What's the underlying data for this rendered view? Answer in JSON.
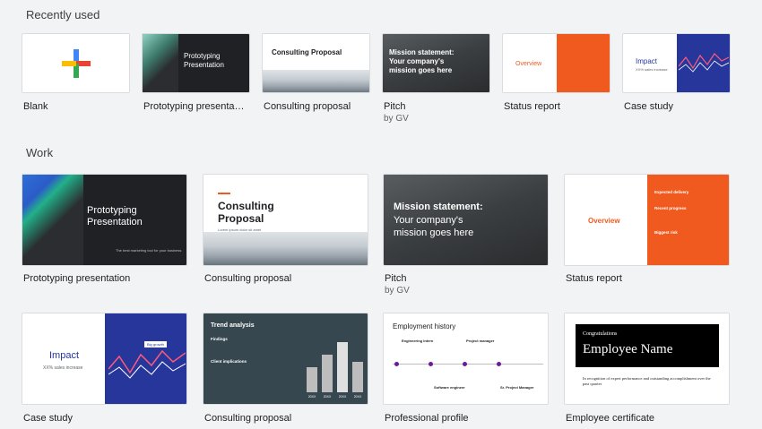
{
  "sections": {
    "recent": "Recently used",
    "work": "Work"
  },
  "recent": [
    {
      "caption": "Blank"
    },
    {
      "caption": "Prototyping presentati…",
      "title": "Prototyping Presentation"
    },
    {
      "caption": "Consulting proposal",
      "title": "Consulting Proposal"
    },
    {
      "caption": "Pitch",
      "sub": "by GV",
      "title": "Mission statement: Your company's mission goes here"
    },
    {
      "caption": "Status report",
      "title": "Overview"
    },
    {
      "caption": "Case study",
      "title": "Impact",
      "subtitle": "XX% sales increase"
    }
  ],
  "work_row1": [
    {
      "caption": "Prototyping presentation",
      "title": "Prototyping Presentation",
      "tag": "The best marketing tool for your business"
    },
    {
      "caption": "Consulting proposal",
      "title": "Consulting Proposal",
      "tag": "Lorem ipsum dolor sit amet"
    },
    {
      "caption": "Pitch",
      "sub": "by GV",
      "title": "Mission statement:",
      "body": "Your company's mission goes here"
    },
    {
      "caption": "Status report",
      "title": "Overview",
      "side1": "Expected delivery",
      "side2": "Recent progress",
      "side3": "Biggest risk"
    }
  ],
  "work_row2": [
    {
      "caption": "Case study",
      "title": "Impact",
      "subtitle": "XX% sales increase",
      "badge": "Big growth"
    },
    {
      "caption": "Consulting proposal",
      "title": "Trend analysis",
      "label1": "Findings",
      "label2": "Client implications",
      "years": [
        "20XX",
        "20XX",
        "20XX",
        "20XX"
      ]
    },
    {
      "caption": "Professional profile",
      "title": "Employment history",
      "jobs": [
        "Engineering Intern",
        "Project manager",
        "Software engineer",
        "Sr. Project Manager"
      ]
    },
    {
      "caption": "Employee certificate",
      "pre": "Congratulations",
      "title": "Employee Name",
      "body": "In recognition of expert performance and outstanding accomplishment over the past quarter"
    }
  ],
  "colors": {
    "orange": "#f05a1e",
    "navy": "#26369b",
    "slate": "#37474f",
    "dark": "#202124"
  }
}
